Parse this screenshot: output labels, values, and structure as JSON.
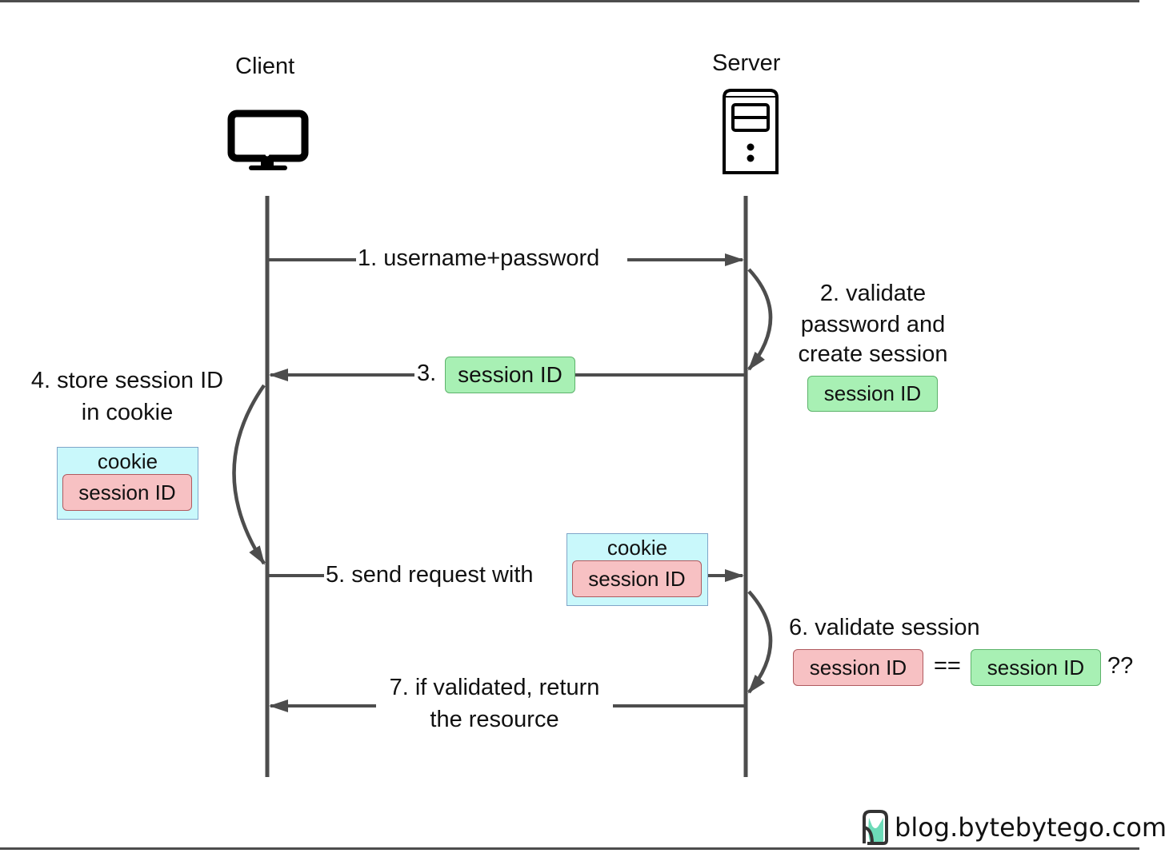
{
  "participants": {
    "client": {
      "label": "Client",
      "icon": "monitor-icon"
    },
    "server": {
      "label": "Server",
      "icon": "server-tower-icon"
    }
  },
  "steps": {
    "s1": "1. username+password",
    "s2_line1": "2. validate",
    "s2_line2": "password and",
    "s2_line3": "create session",
    "s3": "3.",
    "s4_line1": "4. store session ID",
    "s4_line2": "in cookie",
    "s5": "5. send request with",
    "s6": "6. validate session",
    "s7_line1": "7. if validated, return",
    "s7_line2": "the resource"
  },
  "tokens": {
    "session_id": "session ID",
    "cookie": "cookie",
    "equals": "==",
    "question": "??"
  },
  "colors": {
    "server_session": "#a8f0b4",
    "client_session": "#f7c1c3",
    "cookie": "#c9f8fb",
    "line": "#4d4d4d"
  },
  "footer": {
    "brand": "blog.bytebytego.com"
  }
}
